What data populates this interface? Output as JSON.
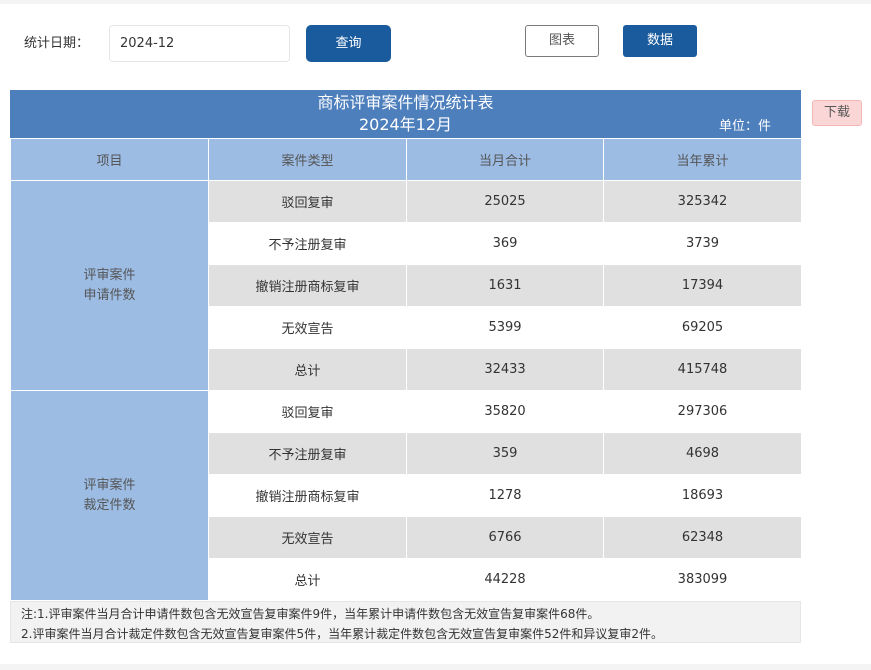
{
  "filter": {
    "label": "统计日期：",
    "date_value": "2024-12",
    "query_label": "查询"
  },
  "view_toggle": {
    "chart_label": "图表",
    "data_label": "数据"
  },
  "download_label": "下载",
  "report": {
    "title": "商标评审案件情况统计表",
    "period": "2024年12月",
    "unit": "单位：件",
    "columns": [
      "项目",
      "案件类型",
      "当月合计",
      "当年累计"
    ],
    "groups": [
      {
        "name_line1": "评审案件",
        "name_line2": "申请件数",
        "rows": [
          {
            "type": "驳回复审",
            "month": "25025",
            "year": "325342"
          },
          {
            "type": "不予注册复审",
            "month": "369",
            "year": "3739"
          },
          {
            "type": "撤销注册商标复审",
            "month": "1631",
            "year": "17394"
          },
          {
            "type": "无效宣告",
            "month": "5399",
            "year": "69205"
          },
          {
            "type": "总计",
            "month": "32433",
            "year": "415748"
          }
        ]
      },
      {
        "name_line1": "评审案件",
        "name_line2": "裁定件数",
        "rows": [
          {
            "type": "驳回复审",
            "month": "35820",
            "year": "297306"
          },
          {
            "type": "不予注册复审",
            "month": "359",
            "year": "4698"
          },
          {
            "type": "撤销注册商标复审",
            "month": "1278",
            "year": "18693"
          },
          {
            "type": "无效宣告",
            "month": "6766",
            "year": "62348"
          },
          {
            "type": "总计",
            "month": "44228",
            "year": "383099"
          }
        ]
      }
    ],
    "notes": [
      "注:1.评审案件当月合计申请件数包含无效宣告复审案件9件，当年累计申请件数包含无效宣告复审案件68件。",
      "2.评审案件当月合计裁定件数包含无效宣告复审案件5件，当年累计裁定件数包含无效宣告复审案件52件和异议复审2件。"
    ]
  }
}
